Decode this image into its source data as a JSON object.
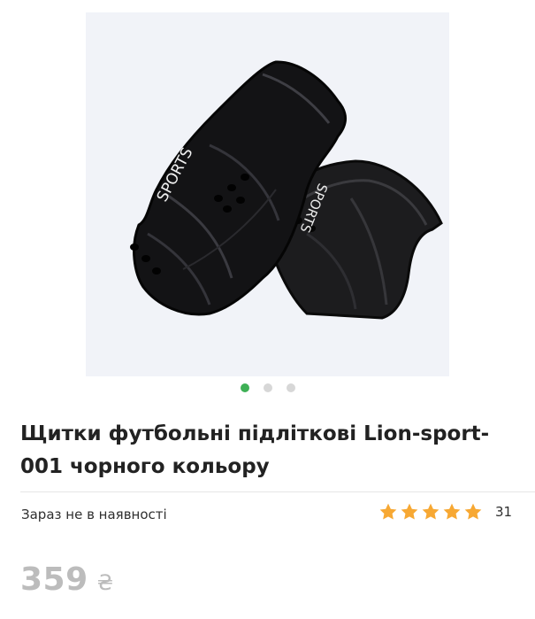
{
  "product": {
    "image": {
      "label": "black shin guards",
      "print_text": "SPORTS"
    },
    "gallery": {
      "dots_total": 3,
      "active_index": 0
    },
    "title": "Щитки футбольні підліткові Lion-sport-001 чорного кольору",
    "availability": "Зараз не в наявності",
    "rating": {
      "value": 5,
      "max": 5,
      "reviews_count": "31"
    },
    "price": {
      "value": "359",
      "currency": "₴"
    }
  },
  "colors": {
    "accent_green": "#3eb055",
    "star_orange": "#f7a833",
    "price_gray": "#bcbcbc",
    "title": "#222222",
    "image_bg": "#f1f3f8"
  }
}
